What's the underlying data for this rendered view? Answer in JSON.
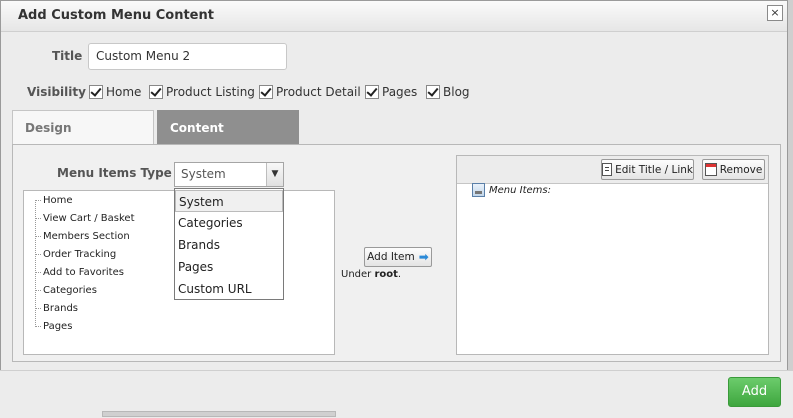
{
  "dialog": {
    "title": "Add Custom Menu Content",
    "close_label": "×"
  },
  "form": {
    "title_label": "Title",
    "title_value": "Custom Menu 2",
    "visibility_label": "Visibility",
    "visibility_options": [
      {
        "label": "Home",
        "checked": true
      },
      {
        "label": "Product Listing",
        "checked": true
      },
      {
        "label": "Product Detail",
        "checked": true
      },
      {
        "label": "Pages",
        "checked": true
      },
      {
        "label": "Blog",
        "checked": true
      }
    ]
  },
  "tabs": [
    {
      "label": "Design",
      "active": false
    },
    {
      "label": "Content",
      "active": true
    }
  ],
  "content": {
    "menu_items_type_label": "Menu Items Type",
    "selected_type": "System",
    "type_options": [
      "System",
      "Categories",
      "Brands",
      "Pages",
      "Custom URL"
    ],
    "tree_items": [
      "Home",
      "View Cart / Basket",
      "Members Section",
      "Order Tracking",
      "Add to Favorites",
      "Categories",
      "Brands",
      "Pages"
    ],
    "add_item_label": "Add Item",
    "under_prefix": "Under ",
    "under_target": "root",
    "under_suffix": ".",
    "edit_title_label": "Edit Title / Link",
    "remove_label": "Remove",
    "menu_items_root": "Menu Items:"
  },
  "footer": {
    "add_label": "Add"
  },
  "colors": {
    "active_tab": "#8f8f8f",
    "add_button": "#4cb34c",
    "arrow": "#2d8bd8"
  }
}
